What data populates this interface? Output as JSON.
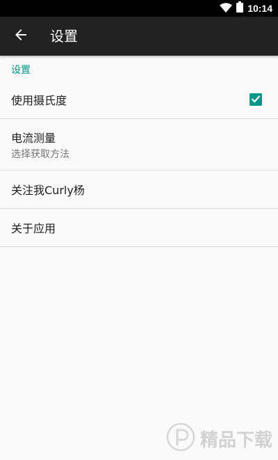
{
  "status_bar": {
    "time": "10:14"
  },
  "toolbar": {
    "title": "设置"
  },
  "section": {
    "header": "设置"
  },
  "items": [
    {
      "title": "使用摄氏度",
      "checked": true
    },
    {
      "title": "电流测量",
      "summary": "选择获取方法"
    },
    {
      "title": "关注我Curly杨"
    },
    {
      "title": "关于应用"
    }
  ],
  "watermark": {
    "text": "精品下载"
  },
  "colors": {
    "accent": "#009688",
    "toolbar": "#212121",
    "background": "#fafafa"
  }
}
